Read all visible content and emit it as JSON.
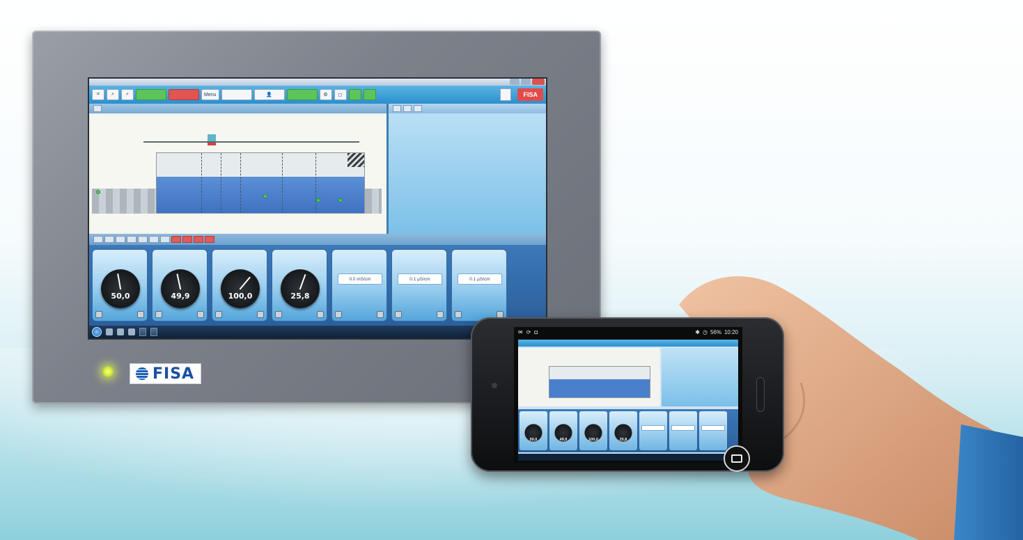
{
  "panel": {
    "brand": "FISA"
  },
  "toolbar": {
    "brand": "FISA",
    "buttons": [
      "",
      "",
      "",
      "",
      "",
      "Menu",
      "",
      "",
      "",
      "",
      "",
      "",
      ""
    ]
  },
  "gauges": [
    {
      "value": "50,0",
      "needle": -10
    },
    {
      "value": "49,9",
      "needle": -12
    },
    {
      "value": "100,0",
      "needle": 40
    },
    {
      "value": "25,8",
      "needle": 20
    }
  ],
  "readouts": [
    {
      "value": "0.0 mS/cm"
    },
    {
      "value": "0.1 µS/cm"
    },
    {
      "value": "0.1 µS/cm"
    }
  ],
  "phone": {
    "status_time": "10:20",
    "battery": "56%",
    "mini_values": [
      "50,0",
      "49,9",
      "100,0",
      "25,8"
    ]
  },
  "colors": {
    "accent_blue": "#2b90cd",
    "brand_red": "#e34b4b",
    "led": "#d5ec2d"
  }
}
